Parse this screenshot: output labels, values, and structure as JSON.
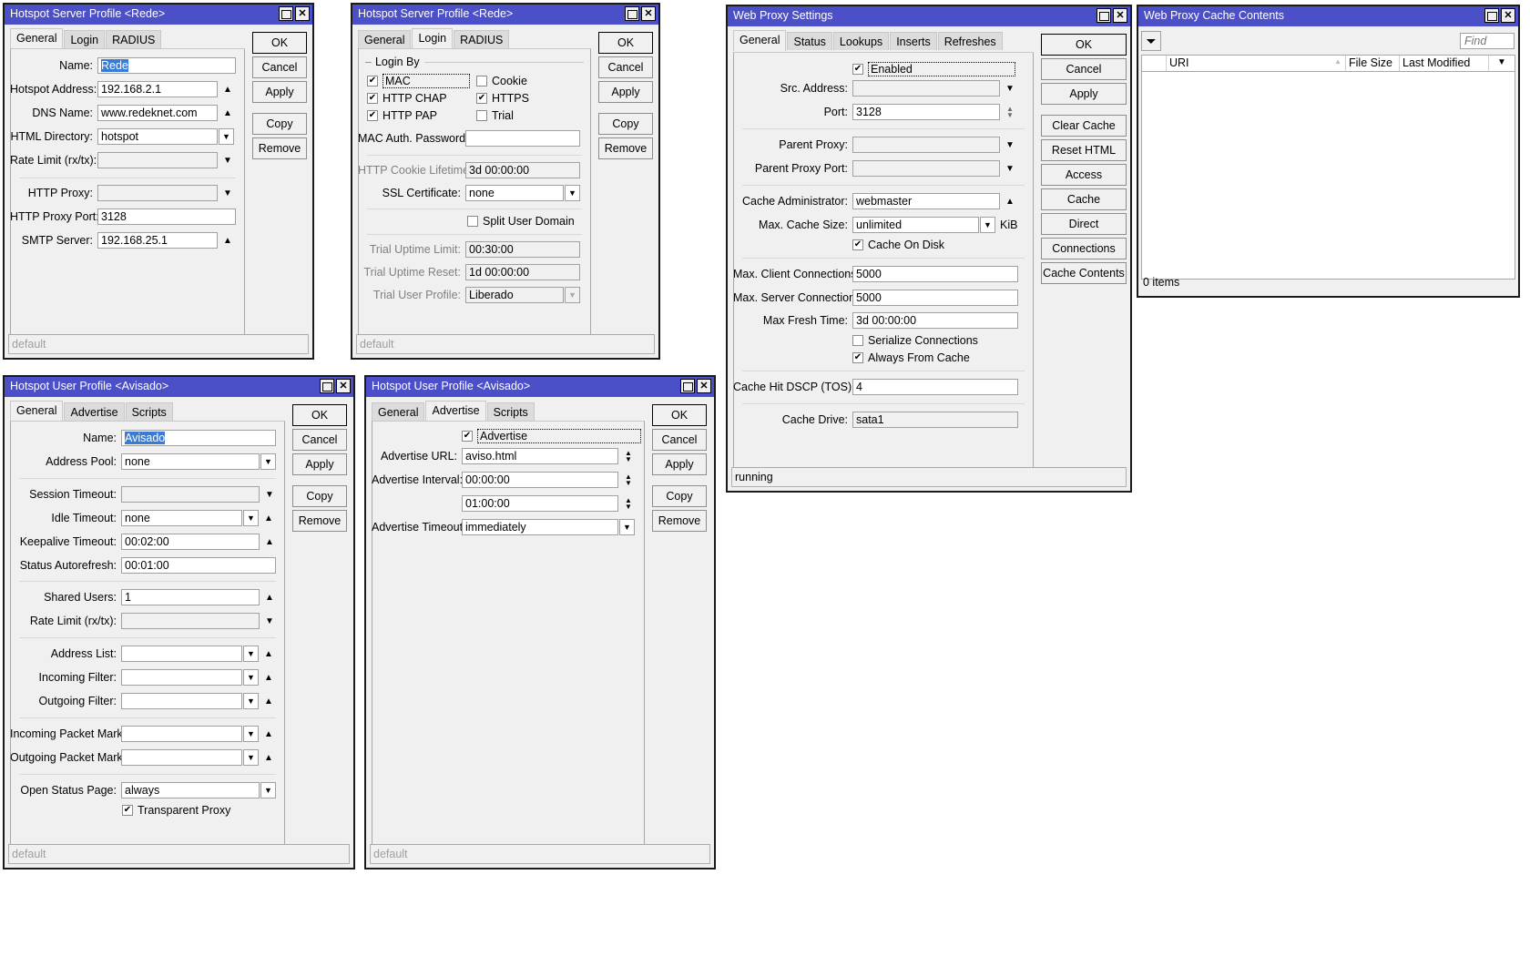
{
  "server_profile_general": {
    "title": "Hotspot Server Profile <Rede>",
    "tabs": [
      "General",
      "Login",
      "RADIUS"
    ],
    "fields": {
      "name": {
        "label": "Name:",
        "value": "Rede"
      },
      "hotspot_address": {
        "label": "Hotspot Address:",
        "value": "192.168.2.1"
      },
      "dns_name": {
        "label": "DNS Name:",
        "value": "www.redeknet.com"
      },
      "html_directory": {
        "label": "HTML Directory:",
        "value": "hotspot"
      },
      "rate_limit": {
        "label": "Rate Limit (rx/tx):",
        "value": ""
      },
      "http_proxy": {
        "label": "HTTP Proxy:",
        "value": ""
      },
      "http_proxy_port": {
        "label": "HTTP Proxy Port:",
        "value": "3128"
      },
      "smtp_server": {
        "label": "SMTP Server:",
        "value": "192.168.25.1"
      }
    },
    "status": "default"
  },
  "server_profile_login": {
    "title": "Hotspot Server Profile <Rede>",
    "tabs": [
      "General",
      "Login",
      "RADIUS"
    ],
    "login_by_label": "Login By",
    "login_by": [
      {
        "label": "MAC",
        "checked": true
      },
      {
        "label": "Cookie",
        "checked": false
      },
      {
        "label": "HTTP CHAP",
        "checked": true
      },
      {
        "label": "HTTPS",
        "checked": true
      },
      {
        "label": "HTTP PAP",
        "checked": true
      },
      {
        "label": "Trial",
        "checked": false
      }
    ],
    "fields": {
      "mac_auth_password": {
        "label": "MAC Auth. Password:",
        "value": ""
      },
      "http_cookie_lifetime": {
        "label": "HTTP Cookie Lifetime:",
        "value": "3d 00:00:00"
      },
      "ssl_certificate": {
        "label": "SSL Certificate:",
        "value": "none"
      },
      "split_user_domain": {
        "label": "Split User Domain",
        "checked": false
      },
      "trial_uptime_limit": {
        "label": "Trial Uptime Limit:",
        "value": "00:30:00"
      },
      "trial_uptime_reset": {
        "label": "Trial Uptime Reset:",
        "value": "1d 00:00:00"
      },
      "trial_user_profile": {
        "label": "Trial User Profile:",
        "value": "Liberado"
      }
    },
    "status": "default"
  },
  "buttons_profile": {
    "ok": "OK",
    "cancel": "Cancel",
    "apply": "Apply",
    "copy": "Copy",
    "remove": "Remove"
  },
  "user_profile_general": {
    "title": "Hotspot User Profile <Avisado>",
    "tabs": [
      "General",
      "Advertise",
      "Scripts"
    ],
    "fields": {
      "name": {
        "label": "Name:",
        "value": "Avisado"
      },
      "address_pool": {
        "label": "Address Pool:",
        "value": "none"
      },
      "session_timeout": {
        "label": "Session Timeout:",
        "value": ""
      },
      "idle_timeout": {
        "label": "Idle Timeout:",
        "value": "none"
      },
      "keepalive_timeout": {
        "label": "Keepalive Timeout:",
        "value": "00:02:00"
      },
      "status_autorefresh": {
        "label": "Status Autorefresh:",
        "value": "00:01:00"
      },
      "shared_users": {
        "label": "Shared Users:",
        "value": "1"
      },
      "rate_limit": {
        "label": "Rate Limit (rx/tx):",
        "value": ""
      },
      "address_list": {
        "label": "Address List:",
        "value": ""
      },
      "incoming_filter": {
        "label": "Incoming Filter:",
        "value": ""
      },
      "outgoing_filter": {
        "label": "Outgoing Filter:",
        "value": ""
      },
      "incoming_packet_mark": {
        "label": "Incoming Packet Mark:",
        "value": ""
      },
      "outgoing_packet_mark": {
        "label": "Outgoing Packet Mark:",
        "value": ""
      },
      "open_status_page": {
        "label": "Open Status Page:",
        "value": "always"
      },
      "transparent_proxy": {
        "label": "Transparent Proxy",
        "checked": true
      }
    },
    "status": "default"
  },
  "user_profile_advertise": {
    "title": "Hotspot User Profile <Avisado>",
    "tabs": [
      "General",
      "Advertise",
      "Scripts"
    ],
    "fields": {
      "advertise": {
        "label": "Advertise",
        "checked": true
      },
      "advertise_url": {
        "label": "Advertise URL:",
        "value": "aviso.html"
      },
      "advertise_interval": {
        "label": "Advertise Interval:",
        "value": "00:00:00"
      },
      "advertise_interval_2": {
        "value": "01:00:00"
      },
      "advertise_timeout": {
        "label": "Advertise Timeout:",
        "value": "immediately"
      }
    },
    "status": "default"
  },
  "web_proxy": {
    "title": "Web Proxy Settings",
    "tabs": [
      "General",
      "Status",
      "Lookups",
      "Inserts",
      "Refreshes"
    ],
    "fields": {
      "enabled": {
        "label": "Enabled",
        "checked": true
      },
      "src_address": {
        "label": "Src. Address:",
        "value": ""
      },
      "port": {
        "label": "Port:",
        "value": "3128"
      },
      "parent_proxy": {
        "label": "Parent Proxy:",
        "value": ""
      },
      "parent_proxy_port": {
        "label": "Parent Proxy Port:",
        "value": ""
      },
      "cache_administrator": {
        "label": "Cache Administrator:",
        "value": "webmaster"
      },
      "max_cache_size": {
        "label": "Max. Cache Size:",
        "value": "unlimited",
        "unit": "KiB"
      },
      "cache_on_disk": {
        "label": "Cache On Disk",
        "checked": true
      },
      "max_client_connections": {
        "label": "Max. Client Connections:",
        "value": "5000"
      },
      "max_server_connections": {
        "label": "Max. Server Connections:",
        "value": "5000"
      },
      "max_fresh_time": {
        "label": "Max Fresh Time:",
        "value": "3d 00:00:00"
      },
      "serialize_connections": {
        "label": "Serialize Connections",
        "checked": false
      },
      "always_from_cache": {
        "label": "Always From Cache",
        "checked": true
      },
      "cache_hit_dscp": {
        "label": "Cache Hit DSCP (TOS):",
        "value": "4"
      },
      "cache_drive": {
        "label": "Cache Drive:",
        "value": "sata1"
      }
    },
    "buttons": {
      "ok": "OK",
      "cancel": "Cancel",
      "apply": "Apply",
      "clear_cache": "Clear Cache",
      "reset_html": "Reset HTML",
      "access": "Access",
      "cache": "Cache",
      "direct": "Direct",
      "connections": "Connections",
      "cache_contents": "Cache Contents"
    },
    "status": "running"
  },
  "cache_contents": {
    "title": "Web Proxy Cache Contents",
    "find_placeholder": "Find",
    "columns": [
      "URI",
      "File Size",
      "Last Modified"
    ],
    "rows": [],
    "status": "0 items"
  }
}
